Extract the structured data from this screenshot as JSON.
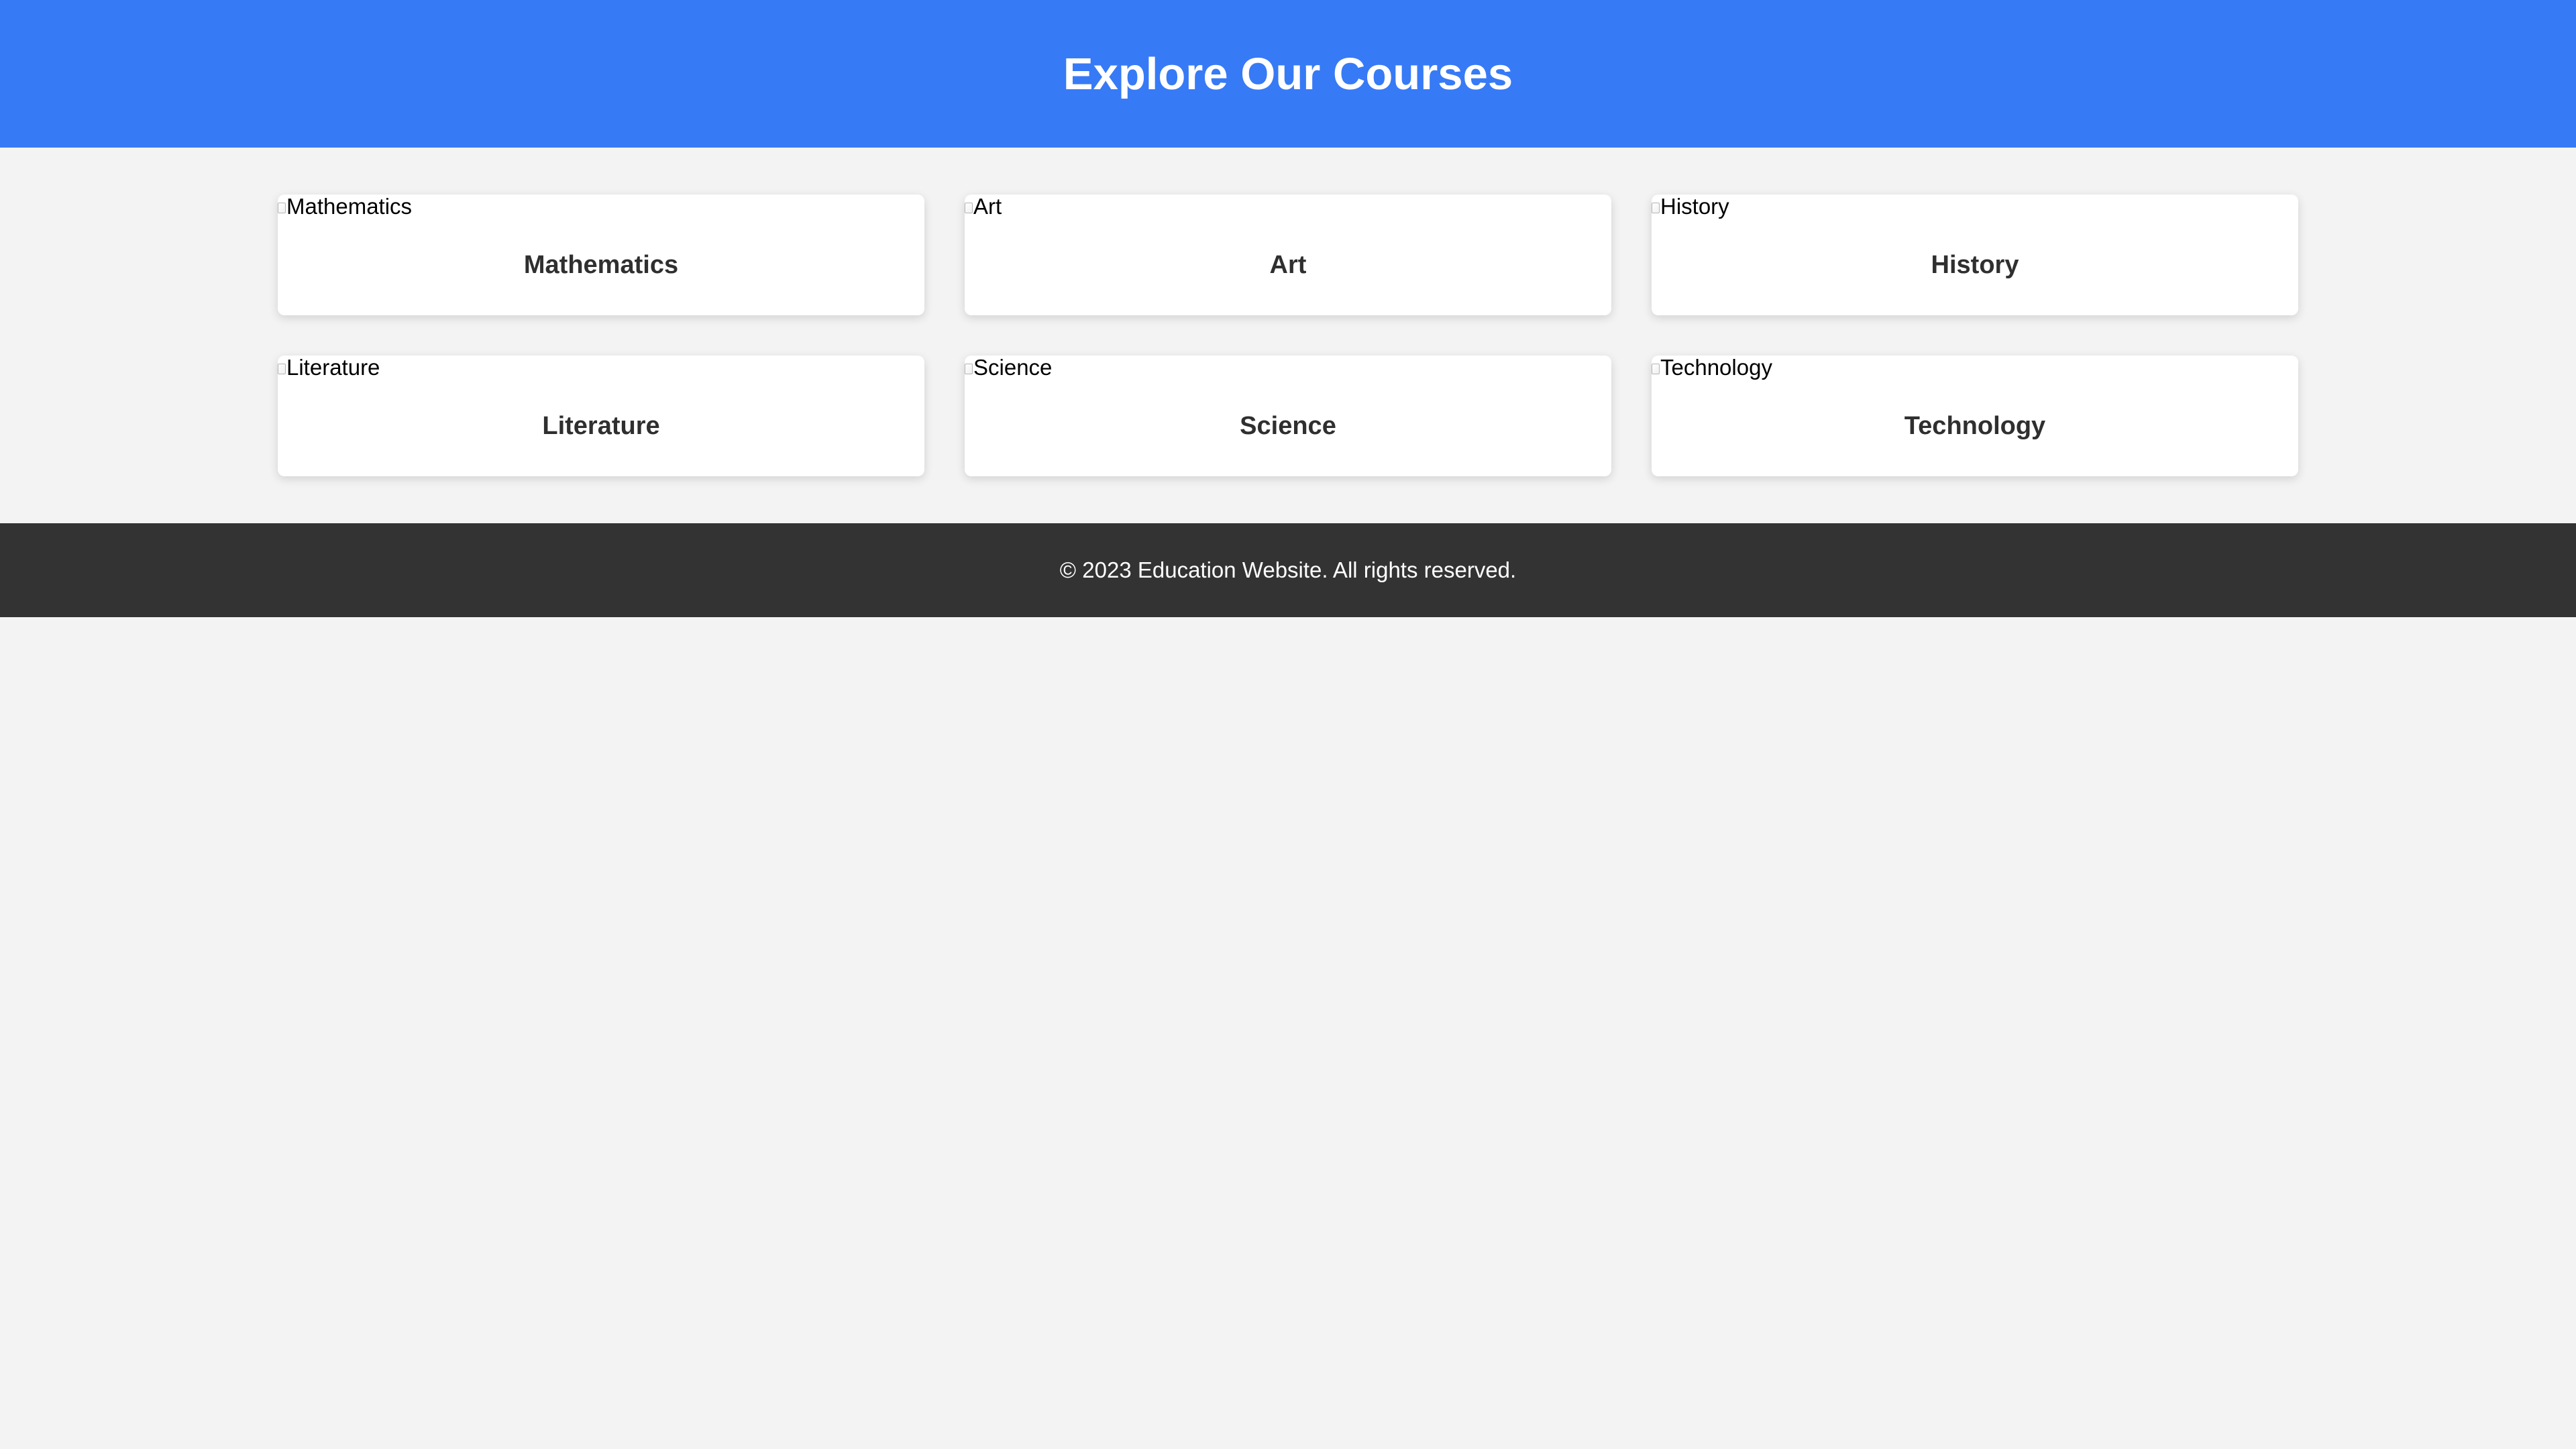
{
  "header": {
    "title": "Explore Our Courses"
  },
  "courses": [
    {
      "image_alt": "Mathematics",
      "title": "Mathematics"
    },
    {
      "image_alt": "Art",
      "title": "Art"
    },
    {
      "image_alt": "History",
      "title": "History"
    },
    {
      "image_alt": "Literature",
      "title": "Literature"
    },
    {
      "image_alt": "Science",
      "title": "Science"
    },
    {
      "image_alt": "Technology",
      "title": "Technology"
    }
  ],
  "footer": {
    "text": "© 2023 Education Website. All rights reserved."
  },
  "colors": {
    "header_bg": "#377af6",
    "page_bg": "#f3f3f3",
    "card_bg": "#ffffff",
    "footer_bg": "#333333"
  }
}
